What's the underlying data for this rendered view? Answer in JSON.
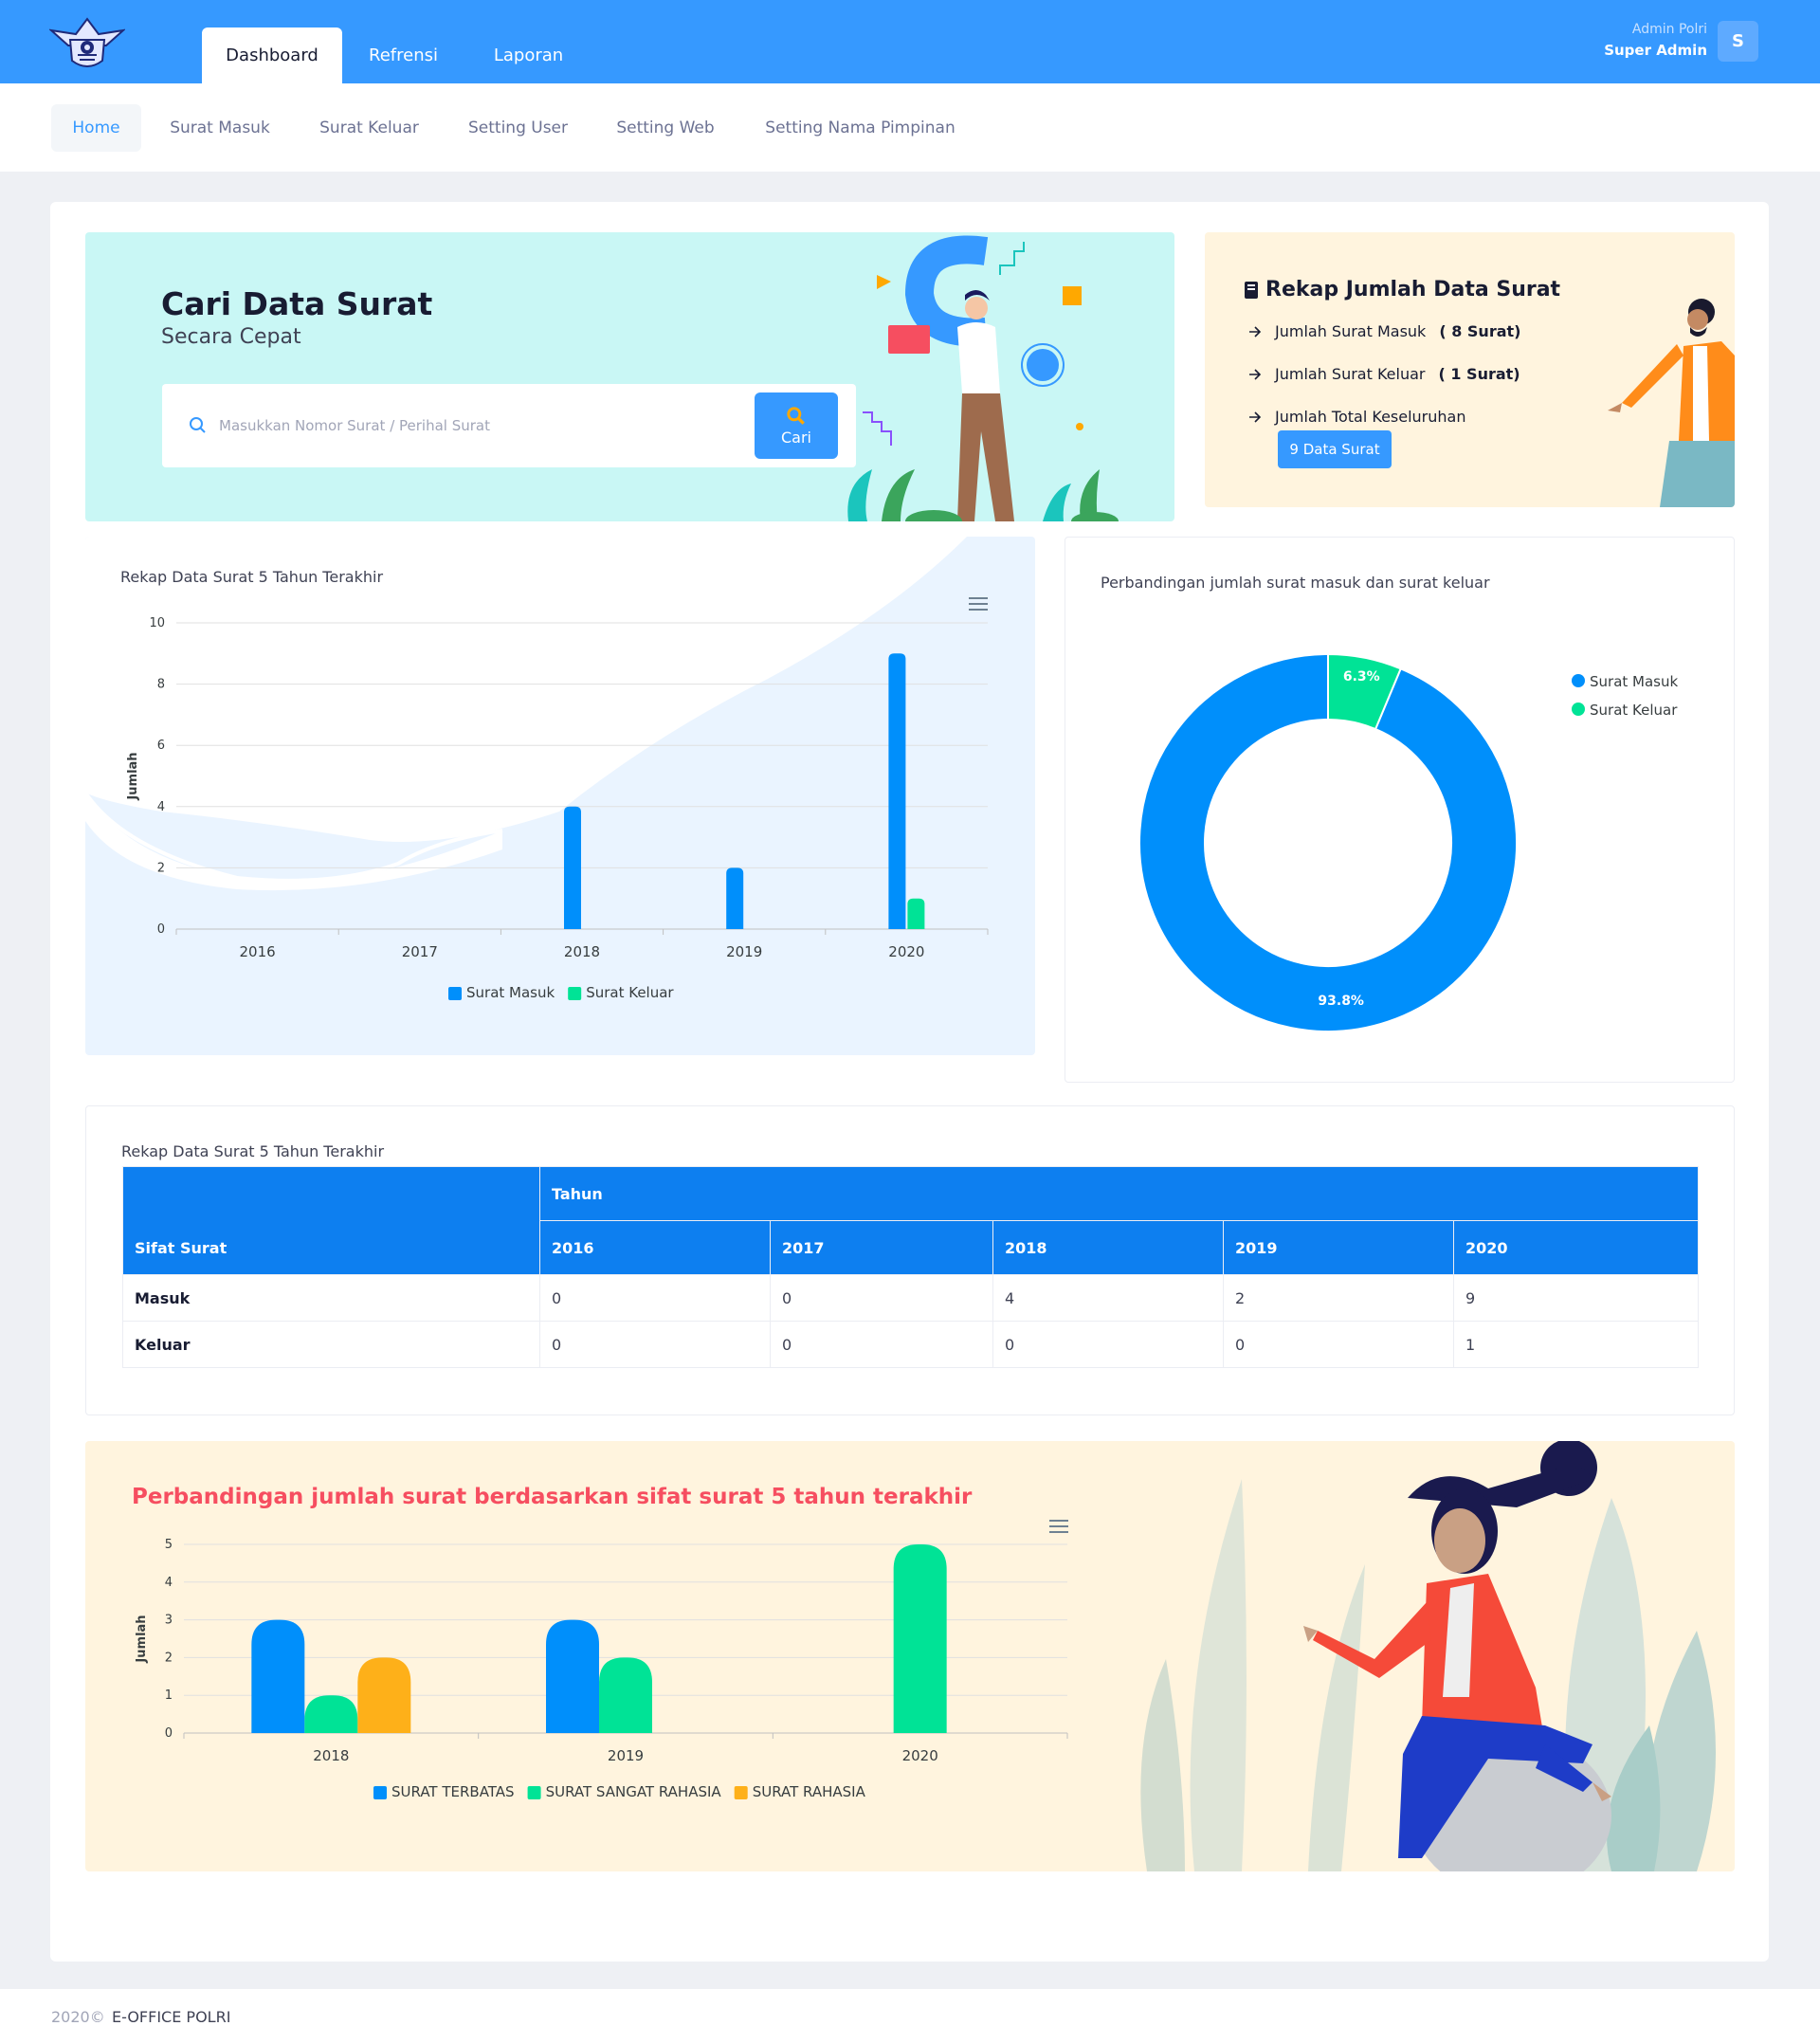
{
  "header": {
    "tabs": [
      "Dashboard",
      "Refrensi",
      "Laporan"
    ],
    "user_role": "Admin Polri",
    "user_name": "Super Admin",
    "avatar_letter": "S"
  },
  "subnav": [
    "Home",
    "Surat Masuk",
    "Surat Keluar",
    "Setting User",
    "Setting Web",
    "Setting Nama Pimpinan"
  ],
  "search": {
    "title": "Cari Data Surat",
    "subtitle": "Secara Cepat",
    "placeholder": "Masukkan Nomor Surat / Perihal Surat",
    "button": "Cari"
  },
  "rekap": {
    "title": "Rekap Jumlah Data Surat",
    "masuk_label": "Jumlah Surat Masuk",
    "masuk_value": "( 8 Surat)",
    "keluar_label": "Jumlah Surat Keluar",
    "keluar_value": "( 1 Surat)",
    "total_label": "Jumlah Total Keseluruhan",
    "total_button": "9 Data Surat"
  },
  "colors": {
    "primary": "#3699ff",
    "bar_blue": "#008ffb",
    "bar_green": "#00e396",
    "bar_orange": "#feb019",
    "danger": "#f64e60"
  },
  "chart_data": [
    {
      "type": "bar",
      "title": "Rekap Data Surat 5 Tahun Terakhir",
      "categories": [
        "2016",
        "2017",
        "2018",
        "2019",
        "2020"
      ],
      "series": [
        {
          "name": "Surat Masuk",
          "values": [
            0,
            0,
            4,
            2,
            9
          ]
        },
        {
          "name": "Surat Keluar",
          "values": [
            0,
            0,
            0,
            0,
            1
          ]
        }
      ],
      "ylabel": "Jumlah",
      "ylim": [
        0,
        10
      ],
      "yticks": [
        0,
        2,
        4,
        6,
        8,
        10
      ],
      "legend": "bottom",
      "grid": true
    },
    {
      "type": "pie",
      "title": "Perbandingan jumlah surat masuk dan surat keluar",
      "labels": [
        "Surat Masuk",
        "Surat Keluar"
      ],
      "values": [
        93.8,
        6.3
      ],
      "value_labels": [
        "93.8%",
        "6.3%"
      ],
      "legend": "top-right"
    },
    {
      "type": "bar",
      "title": "Perbandingan jumlah surat berdasarkan sifat surat 5 tahun terakhir",
      "categories": [
        "2018",
        "2019",
        "2020"
      ],
      "series": [
        {
          "name": "SURAT TERBATAS",
          "values": [
            3,
            3,
            0
          ]
        },
        {
          "name": "SURAT SANGAT RAHASIA",
          "values": [
            1,
            2,
            5
          ]
        },
        {
          "name": "SURAT RAHASIA",
          "values": [
            2,
            0,
            0
          ]
        }
      ],
      "ylabel": "Jumlah",
      "ylim": [
        0,
        5
      ],
      "yticks": [
        0,
        1,
        2,
        3,
        4,
        5
      ],
      "legend": "bottom",
      "grid": true
    }
  ],
  "table": {
    "title": "Rekap Data Surat 5 Tahun Terakhir",
    "col_label": "Sifat Surat",
    "group_label": "Tahun",
    "years": [
      "2016",
      "2017",
      "2018",
      "2019",
      "2020"
    ],
    "rows": [
      {
        "label": "Masuk",
        "values": [
          "0",
          "0",
          "4",
          "2",
          "9"
        ]
      },
      {
        "label": "Keluar",
        "values": [
          "0",
          "0",
          "0",
          "0",
          "1"
        ]
      }
    ]
  },
  "footer": {
    "year": "2020©",
    "name": "E-OFFICE POLRI"
  }
}
